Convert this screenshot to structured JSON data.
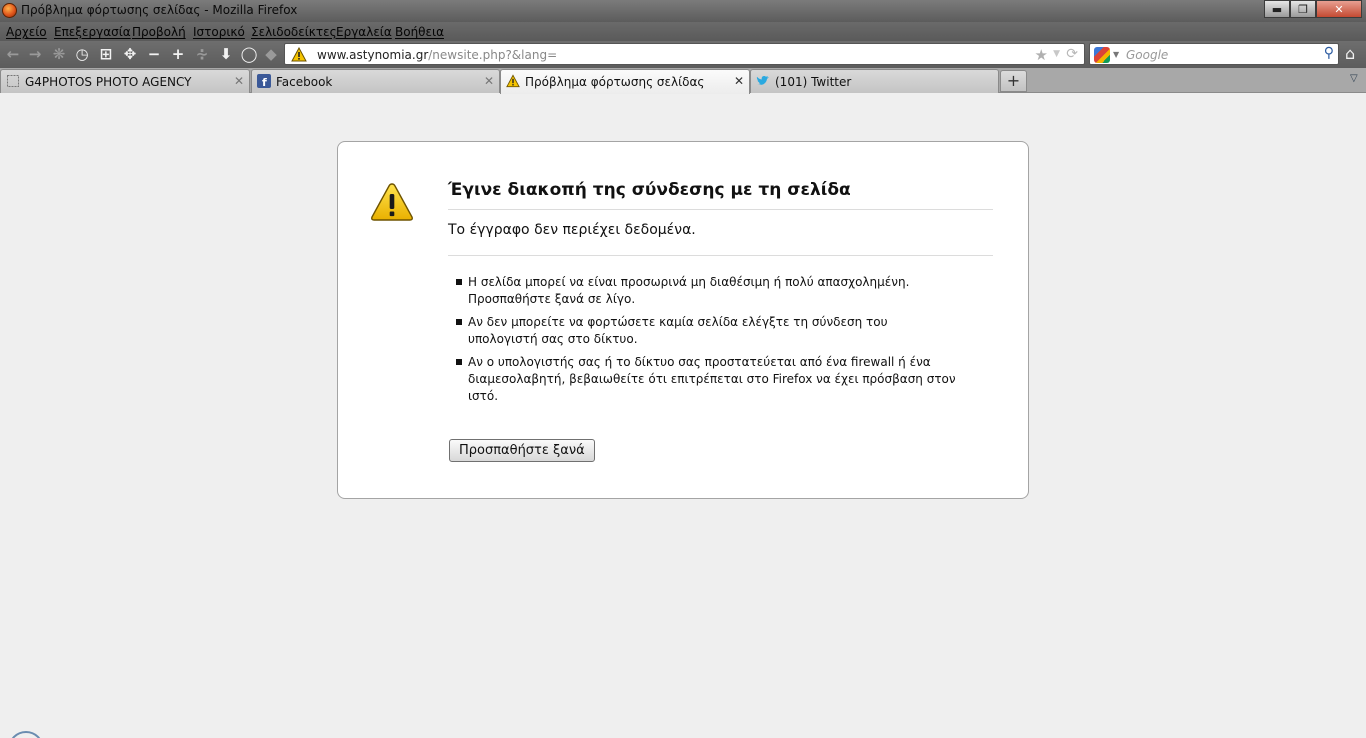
{
  "window": {
    "title": "Πρόβλημα φόρτωσης σελίδας - Mozilla Firefox",
    "minimize_glyph": "▬",
    "maximize_glyph": "❐",
    "close_glyph": "✕"
  },
  "menu": {
    "items": [
      "Αρχείο",
      "Επεξεργασία",
      "Προβολή",
      "Ιστορικό",
      "Σελιδοδείκτες",
      "Εργαλεία",
      "Βοήθεια"
    ]
  },
  "navigation": {
    "url_host": "www.astynomia.gr",
    "url_path": "/newsite.php?&lang=",
    "search_placeholder": "Google"
  },
  "tabs": [
    {
      "label": "G4PHOTOS PHOTO AGENCY",
      "icon": "page-icon",
      "active": false
    },
    {
      "label": "Facebook",
      "icon": "facebook-icon",
      "active": false
    },
    {
      "label": "Πρόβλημα φόρτωσης σελίδας",
      "icon": "warning-icon",
      "active": true
    },
    {
      "label": "(101) Twitter",
      "icon": "twitter-icon",
      "active": false
    }
  ],
  "error_page": {
    "title": "Έγινε διακοπή της σύνδεσης με τη σελίδα",
    "description": "Το έγγραφο δεν περιέχει δεδομένα.",
    "suggestions": [
      "Η σελίδα μπορεί να είναι προσωρινά μη διαθέσιμη ή πολύ απασχολημένη. Προσπαθήστε ξανά σε λίγο.",
      "Αν δεν μπορείτε να φορτώσετε καμία σελίδα ελέγξτε τη σύνδεση του υπολογιστή σας στο δίκτυο.",
      "Αν ο υπολογιστής σας ή το δίκτυο σας προστατεύεται από ένα firewall ή ένα διαμεσολαβητή, βεβαιωθείτε ότι επιτρέπεται στο Firefox να έχει πρόσβαση στον ιστό."
    ],
    "try_again_label": "Προσπαθήστε ξανά"
  },
  "colors": {
    "page_background": "#efefef",
    "chrome_dark": "#5c5c5c",
    "warning_yellow": "#f5c400"
  }
}
